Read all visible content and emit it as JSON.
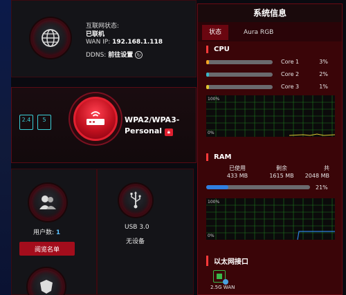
{
  "internet": {
    "status_label": "互联网状态:",
    "status_value": "已联机",
    "wan_label": "WAN IP:",
    "wan_ip": "192.168.1.118",
    "ddns_label": "DDNS:",
    "ddns_value": "前往设置"
  },
  "wireless": {
    "band_24": "2.4",
    "band_5": "5",
    "security_line1": "WPA2/WPA3-",
    "security_line2": "Personal"
  },
  "clients": {
    "label": "用户数:",
    "count": "1",
    "button": "阅览名单"
  },
  "usb": {
    "label": "USB 3.0",
    "status": "无设备"
  },
  "sysinfo": {
    "title": "系统信息",
    "tabs": [
      {
        "label": "状态",
        "active": true
      },
      {
        "label": "Aura RGB",
        "active": false
      }
    ],
    "cpu": {
      "title": "CPU",
      "cores": [
        {
          "name": "Core 1",
          "value": "3%",
          "pct": 3,
          "color": "#f5a623"
        },
        {
          "name": "Core 2",
          "value": "2%",
          "pct": 2,
          "color": "#3ab7c9"
        },
        {
          "name": "Core 3",
          "value": "1%",
          "pct": 1,
          "color": "#e0c830"
        }
      ],
      "graph_top": "100%",
      "graph_bottom": "0%"
    },
    "ram": {
      "title": "RAM",
      "used_label": "已使用",
      "used_value": "433 MB",
      "free_label": "剩余",
      "free_value": "1615 MB",
      "total_label": "共",
      "total_value": "2048 MB",
      "percent": "21%",
      "pct": 21,
      "graph_top": "100%",
      "graph_bottom": "0%"
    },
    "ethernet": {
      "title": "以太网接口",
      "port_label": "2.5G WAN"
    }
  },
  "colors": {
    "accent_red": "#c0101e",
    "panel_bg": "#2a0408",
    "graph_grid": "#1f7a1f"
  }
}
